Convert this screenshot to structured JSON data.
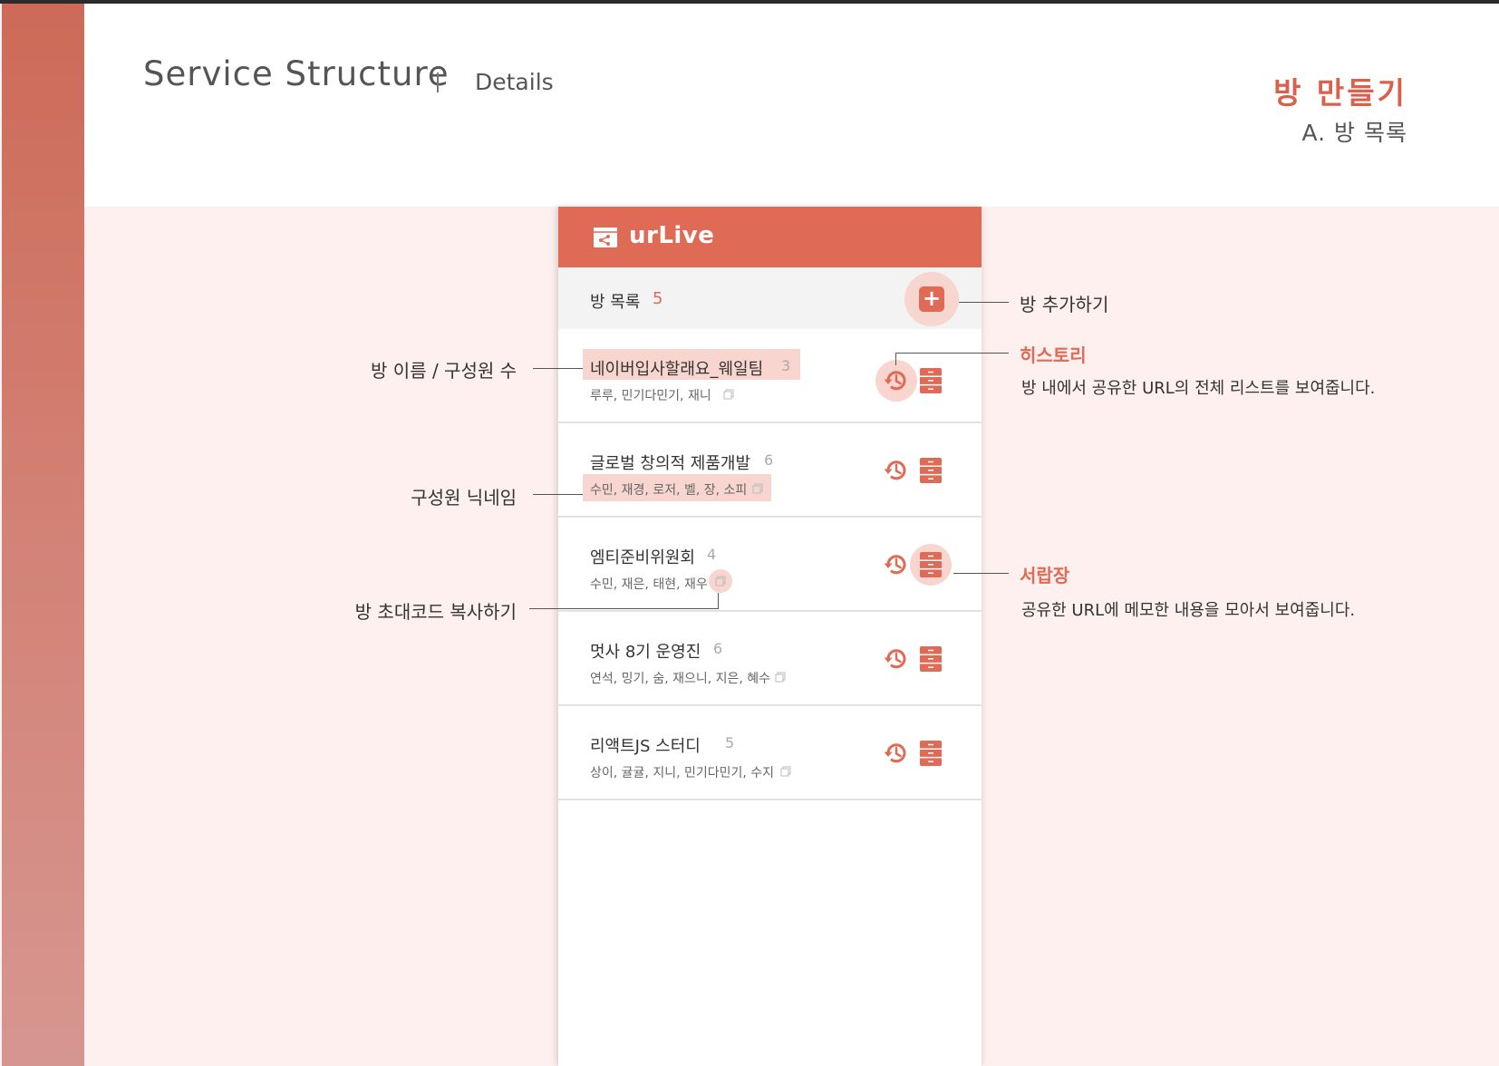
{
  "header": {
    "title": "Service Structure",
    "subtitle": "Details",
    "section_title": "방 만들기",
    "section_sub": "A. 방 목록"
  },
  "app": {
    "logo_text": "urLive",
    "list_label": "방 목록",
    "list_count": "5",
    "add_button": "+"
  },
  "rooms": [
    {
      "name": "네이버입사할래요_웨일팀",
      "count": "3",
      "members": "루루, 민기다민기, 재니"
    },
    {
      "name": "글로벌 창의적 제품개발",
      "count": "6",
      "members": "수민, 재경, 로저, 벨, 장, 소피"
    },
    {
      "name": "엠티준비위원회",
      "count": "4",
      "members": "수민, 재은, 태현, 재우"
    },
    {
      "name": "멋사 8기 운영진",
      "count": "6",
      "members": "연석, 밍기, 숨, 재으니, 지은, 혜수"
    },
    {
      "name": "리액트JS 스터디",
      "count": "5",
      "members": "상이, 귤귤, 지니, 민기다민기, 수지"
    }
  ],
  "annotations": {
    "add_room": "방 추가하기",
    "room_name_count": "방 이름 / 구성원 수",
    "member_nicknames": "구성원 닉네임",
    "copy_invite": "방 초대코드 복사하기",
    "history_title": "히스토리",
    "history_desc": "방 내에서 공유한 URL의 전체 리스트를 보여줍니다.",
    "drawer_title": "서랍장",
    "drawer_desc": "공유한 URL에 메모한 내용을 모아서 보여줍니다."
  },
  "colors": {
    "accent": "#df6a55",
    "highlight": "#f8d6cf",
    "side_stripe": "#cd6a58"
  },
  "icons": [
    "share-logo-icon",
    "plus-icon",
    "history-icon",
    "drawer-icon",
    "copy-icon"
  ]
}
